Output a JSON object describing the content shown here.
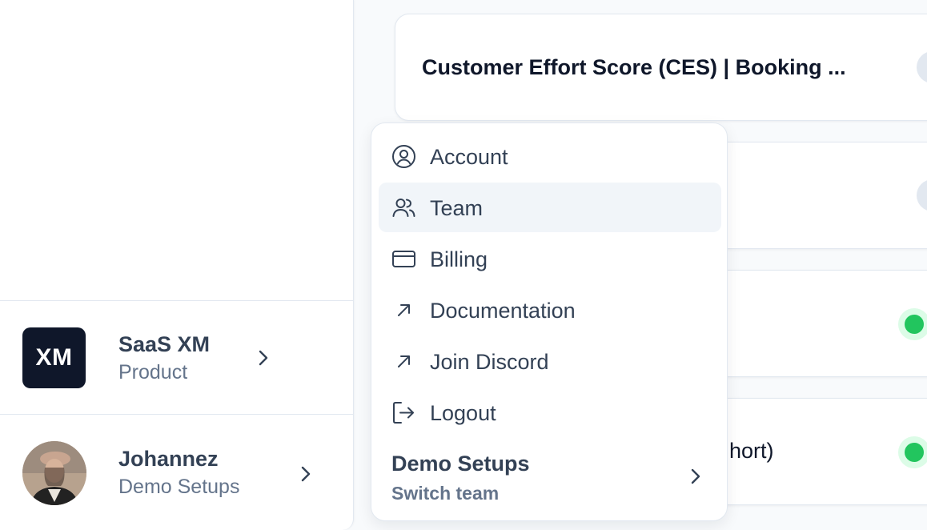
{
  "cards": [
    {
      "title": "Customer Effort Score (CES) | Booking ..."
    },
    {
      "title": ""
    },
    {
      "title": ""
    },
    {
      "title": "hort)"
    }
  ],
  "sidebar": {
    "environment": {
      "logo_text": "XM",
      "title": "SaaS XM",
      "subtitle": "Product"
    },
    "user": {
      "name": "Johannez",
      "team": "Demo Setups"
    }
  },
  "menu": {
    "items": [
      {
        "label": "Account",
        "icon": "user-circle-icon"
      },
      {
        "label": "Team",
        "icon": "users-icon"
      },
      {
        "label": "Billing",
        "icon": "credit-card-icon"
      },
      {
        "label": "Documentation",
        "icon": "arrow-up-right-icon"
      },
      {
        "label": "Join Discord",
        "icon": "arrow-up-right-icon"
      },
      {
        "label": "Logout",
        "icon": "logout-icon"
      }
    ],
    "team_switch": {
      "title": "Demo Setups",
      "subtitle": "Switch team"
    }
  },
  "colors": {
    "status_active": "#22c55e",
    "brand_dark": "#0f172a",
    "menu_hover": "#f1f5f9"
  }
}
